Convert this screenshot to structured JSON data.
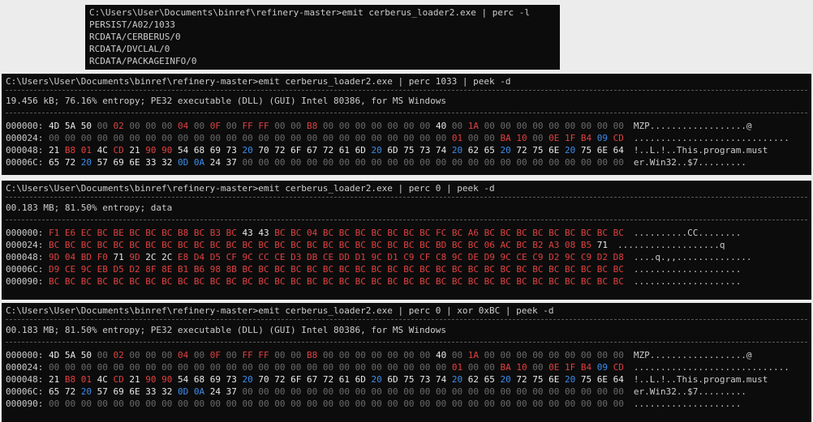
{
  "terminal_list": {
    "command": "C:\\Users\\User\\Documents\\binref\\refinery-master>emit cerberus_loader2.exe | perc -l",
    "resources": [
      "PERSIST/A02/1033",
      "RCDATA/CERBERUS/0",
      "RCDATA/DVCLAL/0",
      "RCDATA/PACKAGEINFO/0"
    ]
  },
  "terminal_1033": {
    "command": "C:\\Users\\User\\Documents\\binref\\refinery-master>emit cerberus_loader2.exe | perc 1033 | peek -d",
    "summary": "19.456 kB; 76.16% entropy; PE32 executable (DLL) (GUI) Intel 80386, for MS Windows",
    "rows": [
      {
        "addr": "000000:",
        "hex": "4D 5A 50 00 02 00 00 00 04 00 0F 00 FF FF 00 00 B8 00 00 00 00 00 00 00 40 00 1A 00 00 00 00 00 00 00 00 00",
        "ascii": "MZP..................@"
      },
      {
        "addr": "000024:",
        "hex": "00 00 00 00 00 00 00 00 00 00 00 00 00 00 00 00 00 00 00 00 00 00 00 00 00 01 00 00 BA 10 00 0E 1F B4 09 CD",
        "ascii": "............................."
      },
      {
        "addr": "000048:",
        "hex": "21 B8 01 4C CD 21 90 90 54 68 69 73 20 70 72 6F 67 72 61 6D 20 6D 75 73 74 20 62 65 20 72 75 6E 20 75 6E 64",
        "ascii": "!..L.!..This.program.must"
      },
      {
        "addr": "00006C:",
        "hex": "65 72 20 57 69 6E 33 32 0D 0A 24 37 00 00 00 00 00 00 00 00 00 00 00 00 00 00 00 00 00 00 00 00 00 00 00 00",
        "ascii": "er.Win32..$7........."
      }
    ]
  },
  "terminal_0": {
    "command": "C:\\Users\\User\\Documents\\binref\\refinery-master>emit cerberus_loader2.exe | perc 0 | peek -d",
    "summary": "00.183 MB; 81.50% entropy; data",
    "rows": [
      {
        "addr": "000000:",
        "hex": "F1 E6 EC BC BE BC BC BC B8 BC B3 BC 43 43 BC BC 04 BC BC BC BC BC BC BC FC BC A6 BC BC BC BC BC BC BC BC BC",
        "ascii": "..........CC........"
      },
      {
        "addr": "000024:",
        "hex": "BC BC BC BC BC BC BC BC BC BC BC BC BC BC BC BC BC BC BC BC BC BC BC BC BD BC BC 06 AC BC B2 A3 08 B5 71",
        "ascii": "...................q"
      },
      {
        "addr": "000048:",
        "hex": "9D 04 BD F0 71 9D 2C 2C E8 D4 D5 CF 9C CC CE D3 DB CE DD D1 9C D1 C9 CF C8 9C DE D9 9C CE C9 D2 9C C9 D2 D8",
        "ascii": "....q.,,.............."
      },
      {
        "addr": "00006C:",
        "hex": "D9 CE 9C EB D5 D2 8F 8E B1 B6 98 8B BC BC BC BC BC BC BC BC BC BC BC BC BC BC BC BC BC BC BC BC BC BC BC BC",
        "ascii": "...................."
      },
      {
        "addr": "000090:",
        "hex": "BC BC BC BC BC BC BC BC BC BC BC BC BC BC BC BC BC BC BC BC BC BC BC BC BC BC BC BC BC BC BC BC BC BC BC BC",
        "ascii": "...................."
      }
    ]
  },
  "terminal_xor": {
    "command": "C:\\Users\\User\\Documents\\binref\\refinery-master>emit cerberus_loader2.exe | perc 0 | xor 0xBC | peek -d",
    "summary": "00.183 MB; 81.50% entropy; PE32 executable (DLL) (GUI) Intel 80386, for MS Windows",
    "rows": [
      {
        "addr": "000000:",
        "hex": "4D 5A 50 00 02 00 00 00 04 00 0F 00 FF FF 00 00 B8 00 00 00 00 00 00 00 40 00 1A 00 00 00 00 00 00 00 00 00",
        "ascii": "MZP..................@"
      },
      {
        "addr": "000024:",
        "hex": "00 00 00 00 00 00 00 00 00 00 00 00 00 00 00 00 00 00 00 00 00 00 00 00 00 01 00 00 BA 10 00 0E 1F B4 09 CD",
        "ascii": "............................."
      },
      {
        "addr": "000048:",
        "hex": "21 B8 01 4C CD 21 90 90 54 68 69 73 20 70 72 6F 67 72 61 6D 20 6D 75 73 74 20 62 65 20 72 75 6E 20 75 6E 64",
        "ascii": "!..L.!..This.program.must"
      },
      {
        "addr": "00006C:",
        "hex": "65 72 20 57 69 6E 33 32 0D 0A 24 37 00 00 00 00 00 00 00 00 00 00 00 00 00 00 00 00 00 00 00 00 00 00 00 00",
        "ascii": "er.Win32..$7........."
      },
      {
        "addr": "000090:",
        "hex": "00 00 00 00 00 00 00 00 00 00 00 00 00 00 00 00 00 00 00 00 00 00 00 00 00 00 00 00 00 00 00 00 00 00 00 00",
        "ascii": "...................."
      }
    ]
  },
  "colors": {
    "terminal_bg": "#0c0c0c",
    "text": "#cccccc",
    "zero_byte": "#6a6a6a",
    "high_byte": "#e04040",
    "whitespace_byte": "#3b8eea",
    "window_bg": "#ececec"
  }
}
